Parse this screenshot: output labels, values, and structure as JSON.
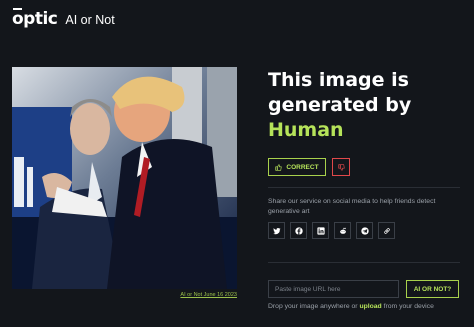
{
  "header": {
    "logo_text": "optic",
    "app_name": "AI or Not"
  },
  "photo": {
    "caption": "AI or Not June 16 2023"
  },
  "result": {
    "line1": "This image is",
    "line2": "generated by",
    "verdict": "Human",
    "verdict_color": "#b6e35a"
  },
  "feedback": {
    "correct_label": "CORRECT",
    "correct_icon": "thumbs-up-icon",
    "wrong_icon": "thumbs-down-icon"
  },
  "share": {
    "text": "Share our service on social media to help friends detect generative art",
    "icons": [
      "twitter-icon",
      "facebook-icon",
      "linkedin-icon",
      "reddit-icon",
      "telegram-icon",
      "link-icon"
    ]
  },
  "search": {
    "placeholder": "Paste image URL here",
    "button_label": "AI OR NOT?",
    "drop_before": "Drop your image anywhere or ",
    "upload_label": "upload",
    "drop_after": " from your device"
  },
  "colors": {
    "accent": "#b6e35a",
    "danger": "#e0484a",
    "background": "#13161b"
  }
}
